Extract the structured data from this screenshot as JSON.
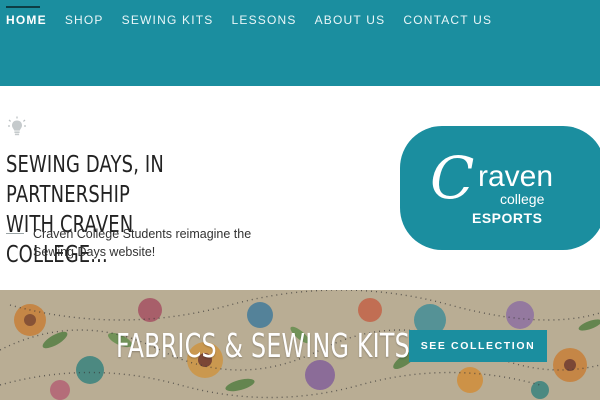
{
  "nav": {
    "items": [
      {
        "label": "HOME",
        "active": true
      },
      {
        "label": "SHOP"
      },
      {
        "label": "SEWING KITS"
      },
      {
        "label": "LESSONS"
      },
      {
        "label": "ABOUT US"
      },
      {
        "label": "CONTACT US"
      }
    ]
  },
  "intro": {
    "icon": "lightbulb-icon",
    "heading_line1": "SEWING DAYS, IN PARTNERSHIP",
    "heading_line2": "WITH CRAVEN COLLEGE...",
    "description": "Craven College Students reimagine the Sewing Days website!"
  },
  "logo": {
    "script_letter": "C",
    "word": "raven",
    "subword": "college",
    "tagline": "ESPORTS"
  },
  "banner": {
    "title": "FABRICS & SEWING KITS",
    "button_label": "SEE COLLECTION"
  },
  "colors": {
    "teal": "#1b8e9f",
    "text_dark": "#222222"
  }
}
